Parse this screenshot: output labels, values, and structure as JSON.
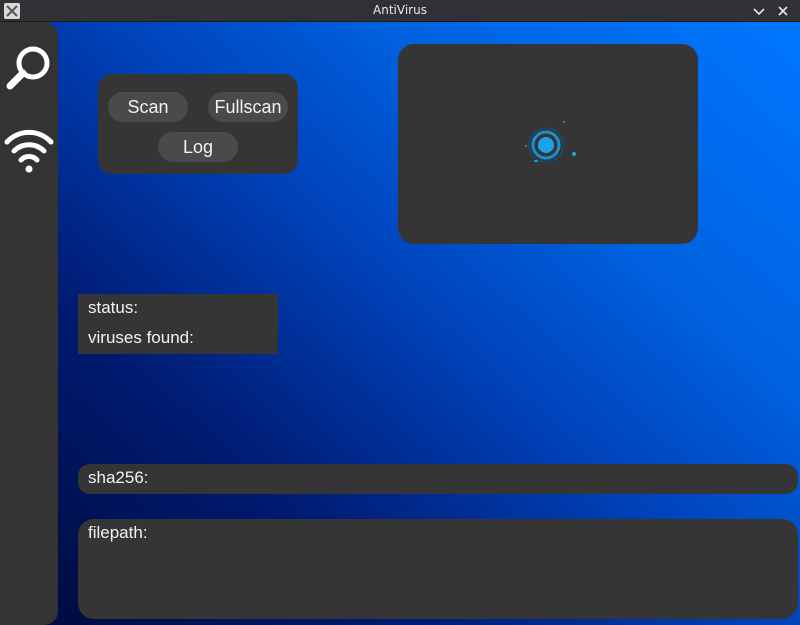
{
  "window": {
    "title": "AntiVirus",
    "controls": [
      "chevron-down-icon",
      "close-icon"
    ]
  },
  "sidebar": {
    "items": [
      {
        "icon": "search-icon"
      },
      {
        "icon": "wifi-icon"
      }
    ]
  },
  "actions": {
    "scan_label": "Scan",
    "fullscan_label": "Fullscan",
    "log_label": "Log"
  },
  "status": {
    "status_label": "status:",
    "viruses_label": "viruses found:"
  },
  "hash": {
    "label": "sha256:"
  },
  "filepath": {
    "label": "filepath:"
  },
  "colors": {
    "panel": "#353535",
    "button": "#4a4a4a",
    "accent": "#1aa3e8",
    "gradient_dark": "#000a3a",
    "gradient_light": "#0076ff"
  }
}
